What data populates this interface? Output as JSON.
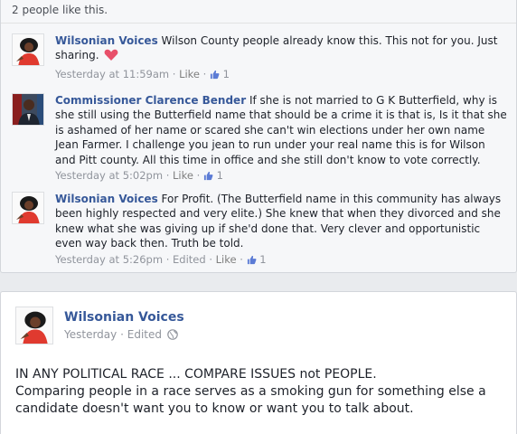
{
  "likes_summary": "2 people like this.",
  "comments": [
    {
      "author": "Wilsonian Voices",
      "text": "Wilson County people already know this. This not for you. Just sharing.",
      "timestamp": "Yesterday at 11:59am",
      "like_label": "Like",
      "edited_label": "",
      "like_count": "1",
      "avatar_icon": "woman-red-dress-avatar-icon",
      "has_heart": true
    },
    {
      "author": "Commissioner Clarence Bender",
      "text": "If she is not married to G K Butterfield, why is she still using the Butterfield name that should be a crime it is that is, Is it that she is ashamed of her name or scared she can't win elections under her own name Jean Farmer. I challenge you jean to run under your real name this is for Wilson and Pitt county. All this time in office and she still don't know to vote correctly.",
      "timestamp": "Yesterday at 5:02pm",
      "like_label": "Like",
      "edited_label": "",
      "like_count": "1",
      "avatar_icon": "man-suit-avatar-icon",
      "has_heart": false
    },
    {
      "author": "Wilsonian Voices",
      "text": "For Profit. (The Butterfield name in this community has always been highly respected and very elite.) She knew that when they divorced and she knew what she was giving up if she'd done that. Very clever and opportunistic even way back then. Truth be told.",
      "timestamp": "Yesterday at 5:26pm",
      "like_label": "Like",
      "edited_label": "Edited",
      "like_count": "1",
      "avatar_icon": "woman-red-dress-avatar-icon",
      "has_heart": false
    }
  ],
  "post": {
    "author": "Wilsonian Voices",
    "timestamp": "Yesterday",
    "edited_label": "Edited",
    "line1": "IN ANY POLITICAL RACE ... COMPARE ISSUES not PEOPLE.",
    "line2": "Comparing people in a race serves as a smoking gun for something else a candidate doesn't want you to know or want you to talk about."
  },
  "colors": {
    "link_blue": "#365899",
    "meta_gray": "#90949c",
    "heart_pink": "#e8506a",
    "like_blue": "#5b7bd5"
  }
}
